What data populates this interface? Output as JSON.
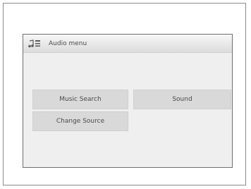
{
  "header": {
    "title": "Audio menu",
    "icon": "music-notes-icon"
  },
  "menu": {
    "items": [
      {
        "label": "Music Search"
      },
      {
        "label": "Sound"
      },
      {
        "label": "Change Source"
      }
    ]
  },
  "colors": {
    "button_background": "#d9d9d9",
    "screen_background": "#efefef",
    "text": "#4a4a4a"
  }
}
